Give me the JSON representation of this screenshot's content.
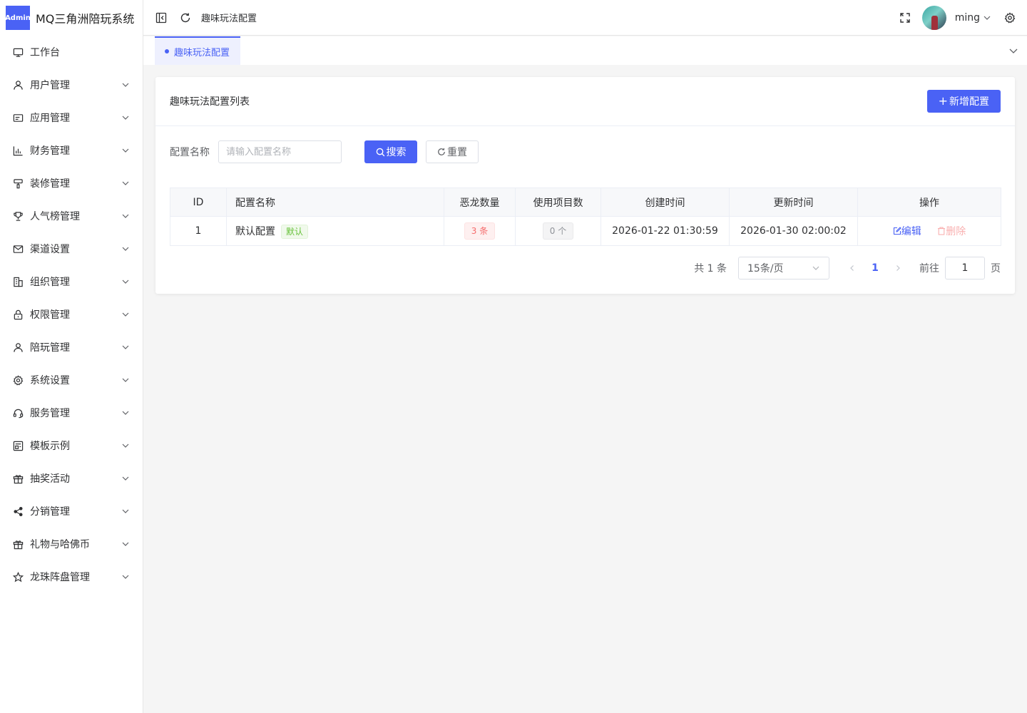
{
  "brand": {
    "logo_text": "Admin",
    "title": "MQ三角洲陪玩系统"
  },
  "sidebar": {
    "items": [
      {
        "label": "工作台",
        "icon": "monitor-icon",
        "expandable": false
      },
      {
        "label": "用户管理",
        "icon": "user-icon",
        "expandable": true
      },
      {
        "label": "应用管理",
        "icon": "app-card-icon",
        "expandable": true
      },
      {
        "label": "财务管理",
        "icon": "chart-icon",
        "expandable": true
      },
      {
        "label": "装修管理",
        "icon": "brush-icon",
        "expandable": true
      },
      {
        "label": "人气榜管理",
        "icon": "trophy-icon",
        "expandable": true
      },
      {
        "label": "渠道设置",
        "icon": "mail-icon",
        "expandable": true
      },
      {
        "label": "组织管理",
        "icon": "building-icon",
        "expandable": true
      },
      {
        "label": "权限管理",
        "icon": "lock-icon",
        "expandable": true
      },
      {
        "label": "陪玩管理",
        "icon": "user-icon",
        "expandable": true
      },
      {
        "label": "系统设置",
        "icon": "gear-icon",
        "expandable": true
      },
      {
        "label": "服务管理",
        "icon": "headset-icon",
        "expandable": true
      },
      {
        "label": "模板示例",
        "icon": "template-icon",
        "expandable": true
      },
      {
        "label": "抽奖活动",
        "icon": "gift-icon",
        "expandable": true
      },
      {
        "label": "分销管理",
        "icon": "share-icon",
        "expandable": true
      },
      {
        "label": "礼物与哈佛币",
        "icon": "gift-icon",
        "expandable": true
      },
      {
        "label": "龙珠阵盘管理",
        "icon": "star-icon",
        "expandable": true
      }
    ]
  },
  "header": {
    "breadcrumb": "趣味玩法配置",
    "user_name": "ming"
  },
  "tabs": [
    {
      "label": "趣味玩法配置",
      "active": true
    }
  ],
  "card": {
    "title": "趣味玩法配置列表",
    "add_button": "新增配置"
  },
  "search": {
    "label": "配置名称",
    "placeholder": "请输入配置名称",
    "value": "",
    "search_button": "搜索",
    "reset_button": "重置"
  },
  "table": {
    "columns": [
      "ID",
      "配置名称",
      "恶龙数量",
      "使用项目数",
      "创建时间",
      "更新时间",
      "操作"
    ],
    "rows": [
      {
        "id": "1",
        "name": "默认配置",
        "default_tag": "默认",
        "dragon_count": "3 条",
        "project_count": "0 个",
        "created_at": "2026-01-22 01:30:59",
        "updated_at": "2026-01-30 02:00:02",
        "edit_label": "编辑",
        "delete_label": "删除"
      }
    ]
  },
  "pagination": {
    "total_text": "共 1 条",
    "page_size": "15条/页",
    "current_page": "1",
    "goto_label": "前往",
    "goto_value": "1",
    "page_suffix": "页"
  },
  "colors": {
    "primary": "#4a62f5",
    "danger": "#f56c6c",
    "success": "#67c23a"
  }
}
